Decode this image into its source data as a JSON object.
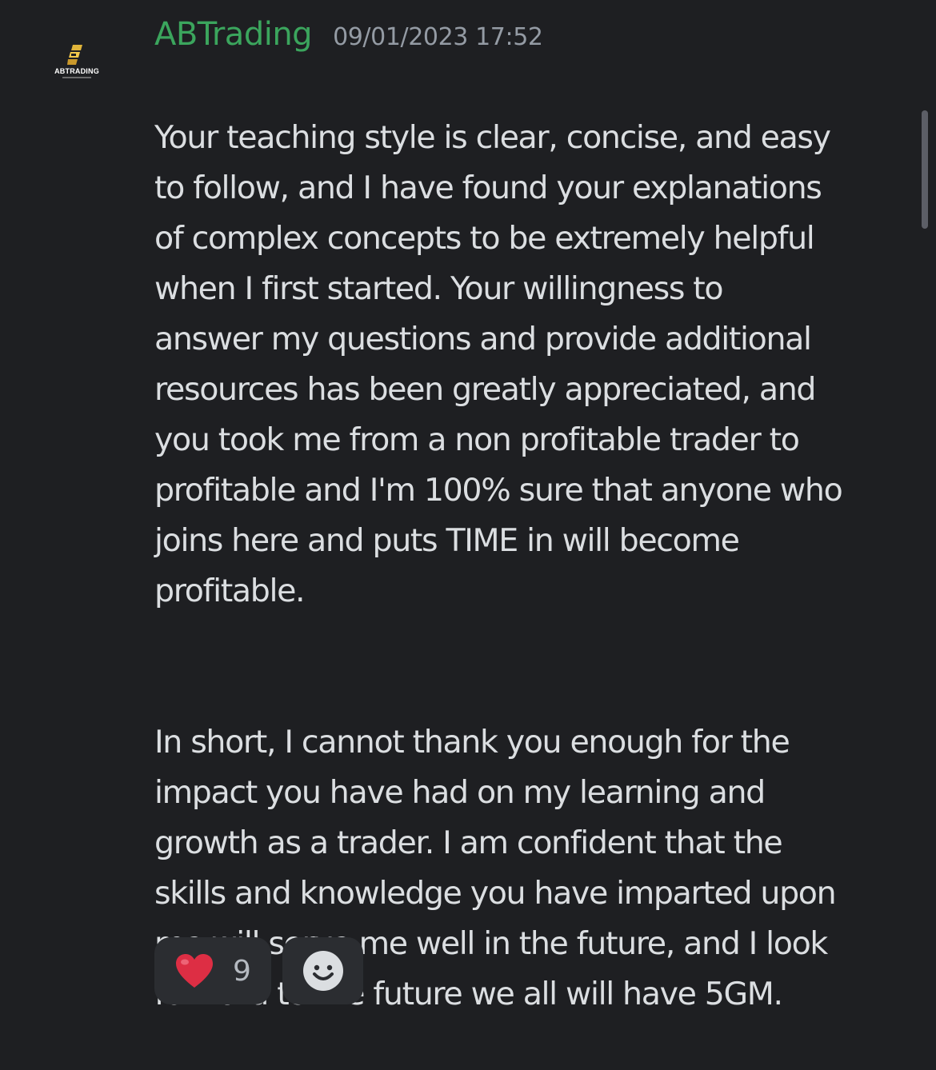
{
  "avatar": {
    "brand": "ABTRADING",
    "icon": "abtrading-logo-icon"
  },
  "message": {
    "author": "ABTrading",
    "timestamp": "09/01/2023 17:52",
    "paragraphs": [
      "Your teaching style is clear, concise, and easy\nto follow, and I have found your explanations\nof complex concepts to be extremely helpful\nwhen I first started. Your willingness to\nanswer my questions and provide additional\nresources has been greatly appreciated, and\nyou took me from a non profitable trader to\nprofitable and I'm 100% sure that anyone who\njoins here and puts TIME in will become\nprofitable.",
      "In short, I cannot thank you enough for the\nimpact you have had on my learning and\ngrowth as a trader. I am confident that the\nskills and knowledge you have imparted upon\nme will serve me well in the future, and I look\nforward to the future we all will have 5GM."
    ]
  },
  "reactions": [
    {
      "emoji": "heart-icon",
      "count": "9"
    }
  ],
  "add_reaction": {
    "icon": "smile-icon"
  },
  "colors": {
    "background": "#1e1f22",
    "author": "#3ba55d",
    "timestamp": "#949ba4",
    "text": "#dbdee1",
    "reaction_bg": "#2b2d31",
    "heart": "#dd2e44"
  }
}
